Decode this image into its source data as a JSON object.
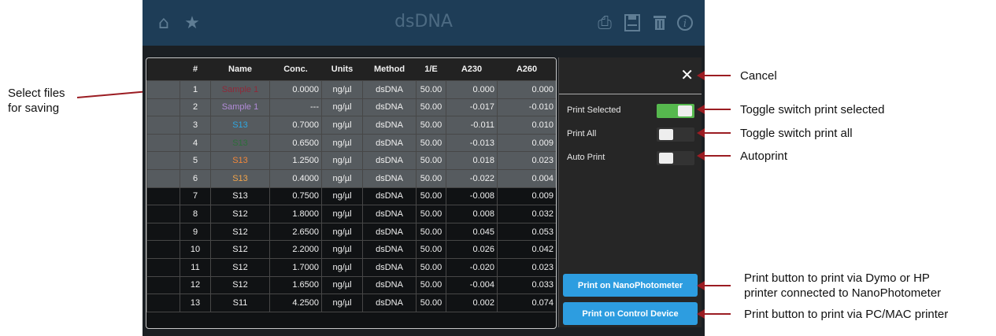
{
  "window": {
    "title": "dsDNA",
    "left_icons": [
      "home-icon",
      "star-icon"
    ],
    "right_icons": [
      "print-icon",
      "save-icon",
      "trash-icon",
      "info-icon"
    ]
  },
  "table": {
    "columns": [
      "#",
      "Name",
      "Conc.",
      "Units",
      "Method",
      "1/E",
      "A230",
      "A260"
    ],
    "rows": [
      {
        "num": "1",
        "name": "Sample 1",
        "conc": "0.0000",
        "units": "ng/µl",
        "method": "dsDNA",
        "inv_e": "50.00",
        "a230": "0.000",
        "a260": "0.000",
        "name_color": "#8e2a3a",
        "selected": true
      },
      {
        "num": "2",
        "name": "Sample 1",
        "conc": "---",
        "units": "ng/µl",
        "method": "dsDNA",
        "inv_e": "50.00",
        "a230": "-0.017",
        "a260": "-0.010",
        "name_color": "#b28bd8",
        "selected": true
      },
      {
        "num": "3",
        "name": "S13",
        "conc": "0.7000",
        "units": "ng/µl",
        "method": "dsDNA",
        "inv_e": "50.00",
        "a230": "-0.011",
        "a260": "0.010",
        "name_color": "#2fa7e0",
        "selected": true
      },
      {
        "num": "4",
        "name": "S13",
        "conc": "0.6500",
        "units": "ng/µl",
        "method": "dsDNA",
        "inv_e": "50.00",
        "a230": "-0.013",
        "a260": "0.009",
        "name_color": "#2d6e3a",
        "selected": true
      },
      {
        "num": "5",
        "name": "S13",
        "conc": "1.2500",
        "units": "ng/µl",
        "method": "dsDNA",
        "inv_e": "50.00",
        "a230": "0.018",
        "a260": "0.023",
        "name_color": "#f2873a",
        "selected": true
      },
      {
        "num": "6",
        "name": "S13",
        "conc": "0.4000",
        "units": "ng/µl",
        "method": "dsDNA",
        "inv_e": "50.00",
        "a230": "-0.022",
        "a260": "0.004",
        "name_color": "#f0a34a",
        "selected": true
      },
      {
        "num": "7",
        "name": "S13",
        "conc": "0.7500",
        "units": "ng/µl",
        "method": "dsDNA",
        "inv_e": "50.00",
        "a230": "-0.008",
        "a260": "0.009",
        "name_color": "#f1f1f1",
        "selected": false
      },
      {
        "num": "8",
        "name": "S12",
        "conc": "1.8000",
        "units": "ng/µl",
        "method": "dsDNA",
        "inv_e": "50.00",
        "a230": "0.008",
        "a260": "0.032",
        "name_color": "#f1f1f1",
        "selected": false
      },
      {
        "num": "9",
        "name": "S12",
        "conc": "2.6500",
        "units": "ng/µl",
        "method": "dsDNA",
        "inv_e": "50.00",
        "a230": "0.045",
        "a260": "0.053",
        "name_color": "#f1f1f1",
        "selected": false
      },
      {
        "num": "10",
        "name": "S12",
        "conc": "2.2000",
        "units": "ng/µl",
        "method": "dsDNA",
        "inv_e": "50.00",
        "a230": "0.026",
        "a260": "0.042",
        "name_color": "#f1f1f1",
        "selected": false
      },
      {
        "num": "11",
        "name": "S12",
        "conc": "1.7000",
        "units": "ng/µl",
        "method": "dsDNA",
        "inv_e": "50.00",
        "a230": "-0.020",
        "a260": "0.023",
        "name_color": "#f1f1f1",
        "selected": false
      },
      {
        "num": "12",
        "name": "S12",
        "conc": "1.6500",
        "units": "ng/µl",
        "method": "dsDNA",
        "inv_e": "50.00",
        "a230": "-0.004",
        "a260": "0.033",
        "name_color": "#f1f1f1",
        "selected": false
      },
      {
        "num": "13",
        "name": "S11",
        "conc": "4.2500",
        "units": "ng/µl",
        "method": "dsDNA",
        "inv_e": "50.00",
        "a230": "0.002",
        "a260": "0.074",
        "name_color": "#f1f1f1",
        "selected": false
      }
    ]
  },
  "print_panel": {
    "close_icon": "close-icon",
    "print_selected_label": "Print Selected",
    "print_selected_on": true,
    "print_all_label": "Print All",
    "print_all_on": false,
    "auto_print_label": "Auto Print",
    "auto_print_on": false,
    "btn_nanophotometer": "Print on NanoPhotometer",
    "btn_control_device": "Print on Control Device"
  },
  "annotations": {
    "select_files": "Select files\nfor saving",
    "cancel": "Cancel",
    "toggle_print_selected": "Toggle switch print selected",
    "toggle_print_all": "Toggle switch print all",
    "autoprint": "Autoprint",
    "print_nano": "Print button to print via Dymo or HP\nprinter connected to NanoPhotometer",
    "print_pc": "Print button to print via PC/MAC printer"
  },
  "colors": {
    "topbar": "#1e3d57",
    "selected_row": "#565b5f",
    "toggle_on": "#56b84e",
    "button_blue": "#2d9de0",
    "arrow": "#9b1c22"
  }
}
